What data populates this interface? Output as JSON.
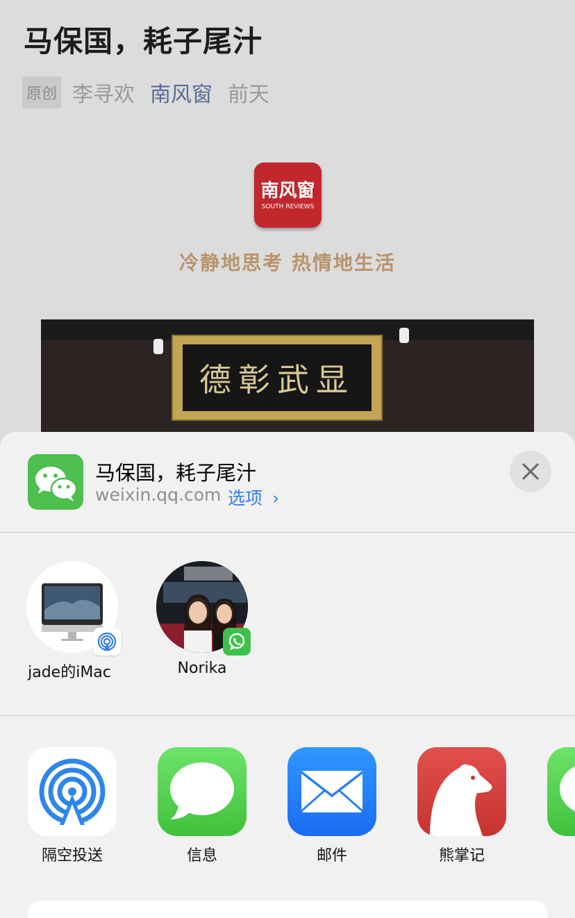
{
  "article": {
    "title": "马保国，耗子尾汁",
    "original_tag": "原创",
    "author": "李寻欢",
    "account": "南风窗",
    "date": "前天",
    "logo_cn": "南风窗",
    "logo_en": "SOUTH REVIEWS",
    "slogan": "冷静地思考 热情地生活",
    "photo_plaque": "德彰武显"
  },
  "share_sheet": {
    "title": "马保国，耗子尾汁",
    "domain": "weixin.qq.com",
    "options_label": "选项",
    "options_chevron": "›",
    "close_icon": "close-icon",
    "people": [
      {
        "name": "jade的iMac",
        "badge": "airdrop-badge-icon"
      },
      {
        "name": "Norika",
        "badge": "whatsapp-badge-icon"
      }
    ],
    "apps": [
      {
        "label": "隔空投送",
        "icon": "airdrop-icon"
      },
      {
        "label": "信息",
        "icon": "messages-icon"
      },
      {
        "label": "邮件",
        "icon": "mail-icon"
      },
      {
        "label": "熊掌记",
        "icon": "bear-icon"
      }
    ]
  },
  "colors": {
    "wechat_green": "#4cbf4c",
    "link_blue": "#2f7cf6",
    "account_blue": "#576b95",
    "logo_red": "#c1272d"
  }
}
